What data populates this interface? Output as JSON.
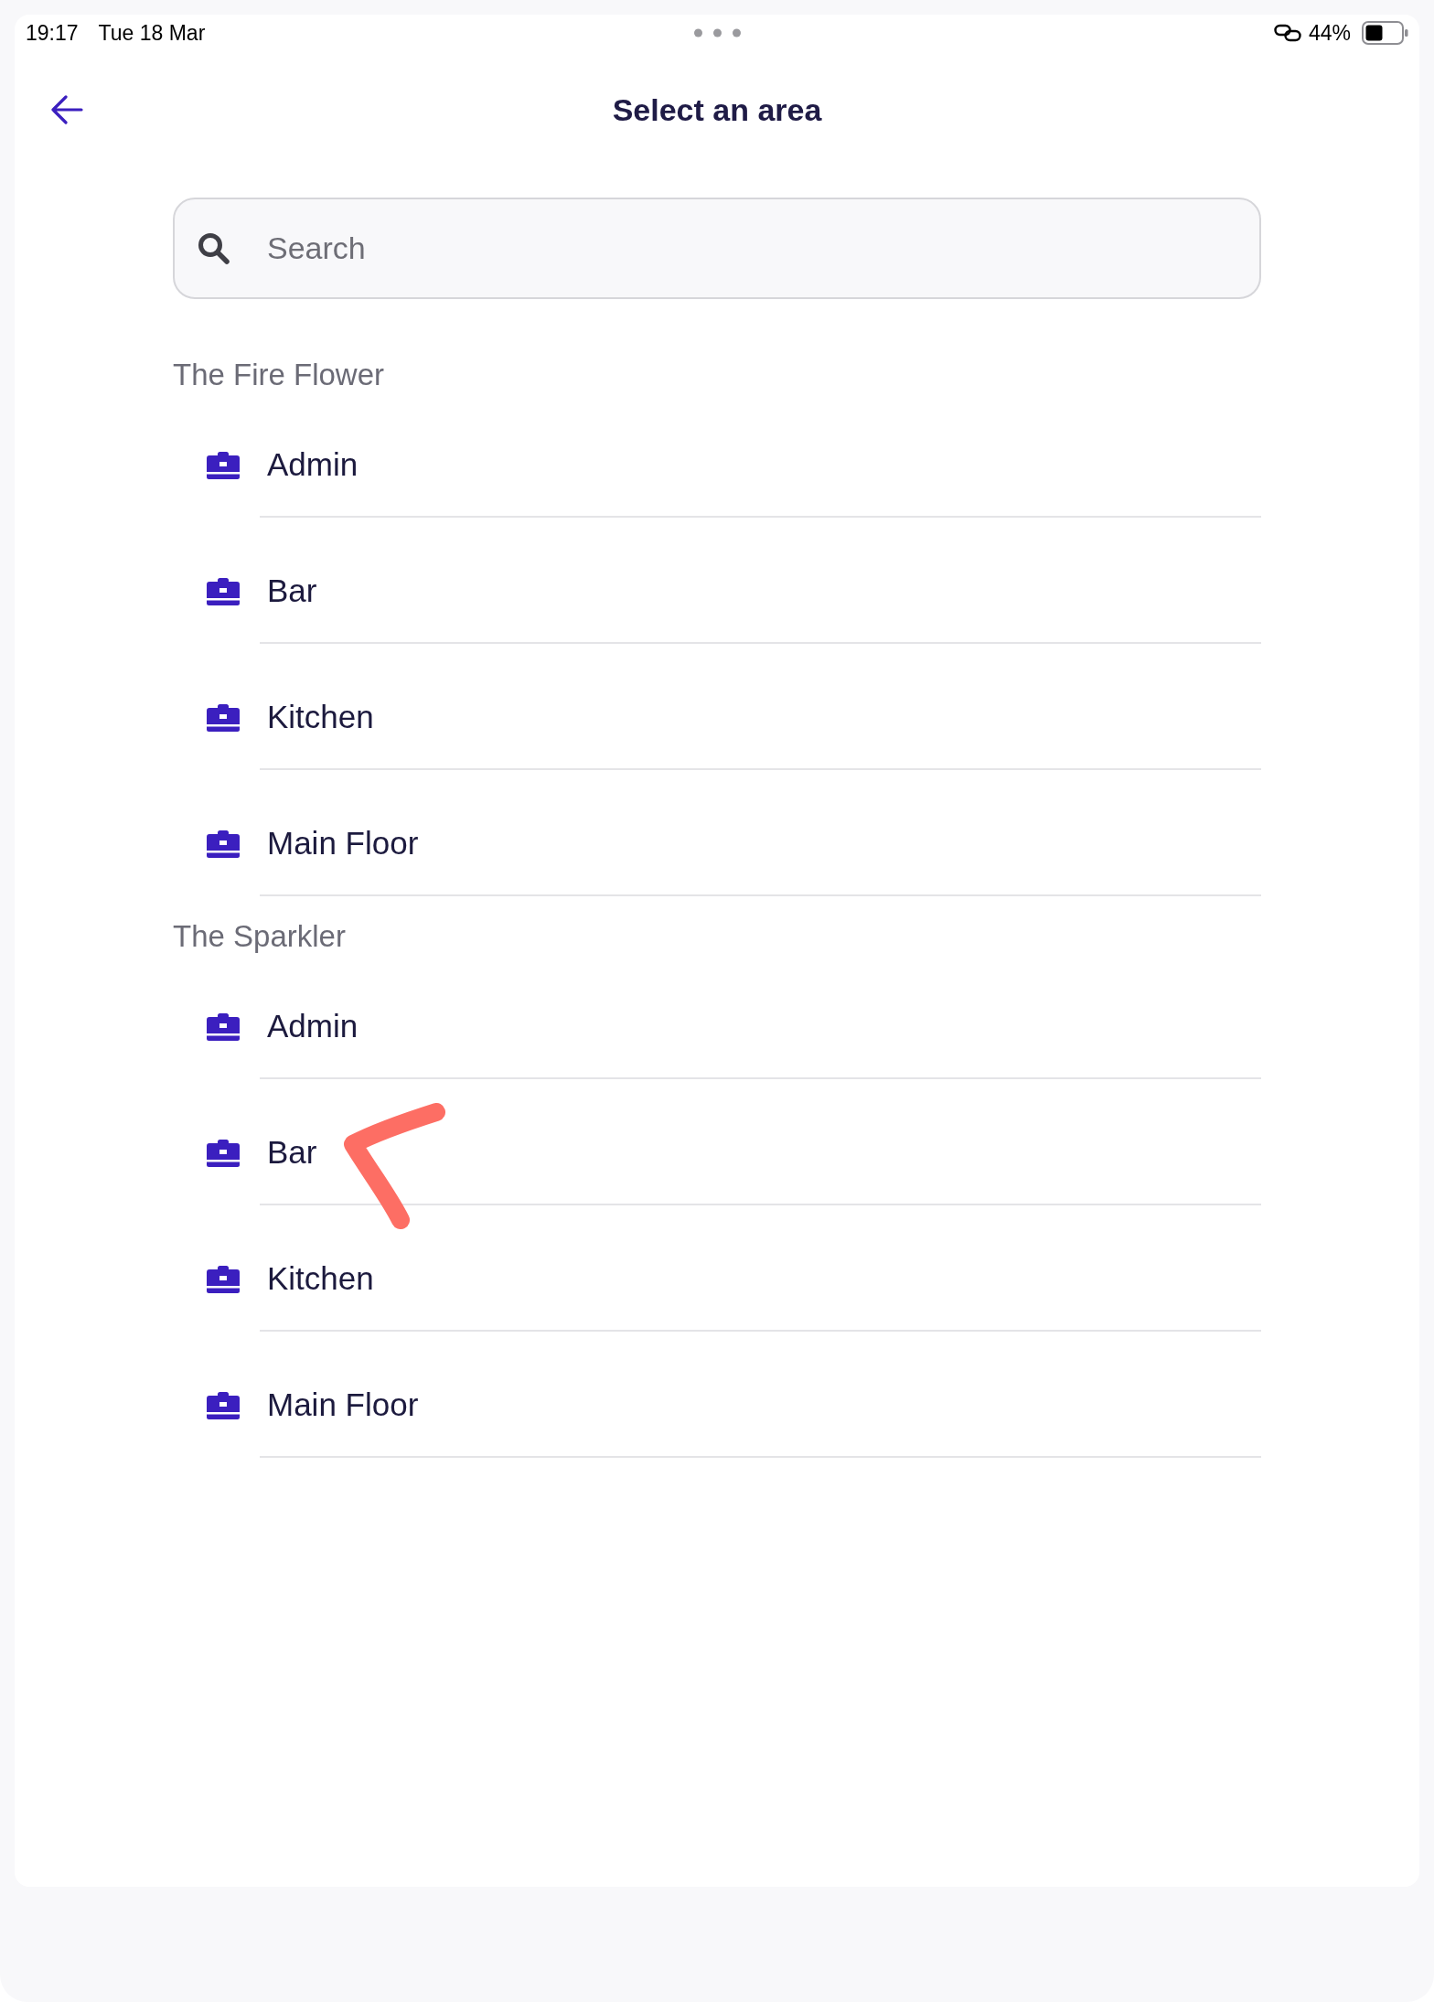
{
  "status_bar": {
    "time": "19:17",
    "date": "Tue 18 Mar",
    "battery": "44%"
  },
  "header": {
    "title": "Select an area"
  },
  "search": {
    "placeholder": "Search"
  },
  "sections": [
    {
      "title": "The Fire Flower",
      "items": [
        {
          "label": "Admin",
          "marked": false
        },
        {
          "label": "Bar",
          "marked": false
        },
        {
          "label": "Kitchen",
          "marked": false
        },
        {
          "label": "Main Floor",
          "marked": false
        }
      ]
    },
    {
      "title": "The Sparkler",
      "items": [
        {
          "label": "Admin",
          "marked": false
        },
        {
          "label": "Bar",
          "marked": true
        },
        {
          "label": "Kitchen",
          "marked": false
        },
        {
          "label": "Main Floor",
          "marked": false
        }
      ]
    }
  ]
}
